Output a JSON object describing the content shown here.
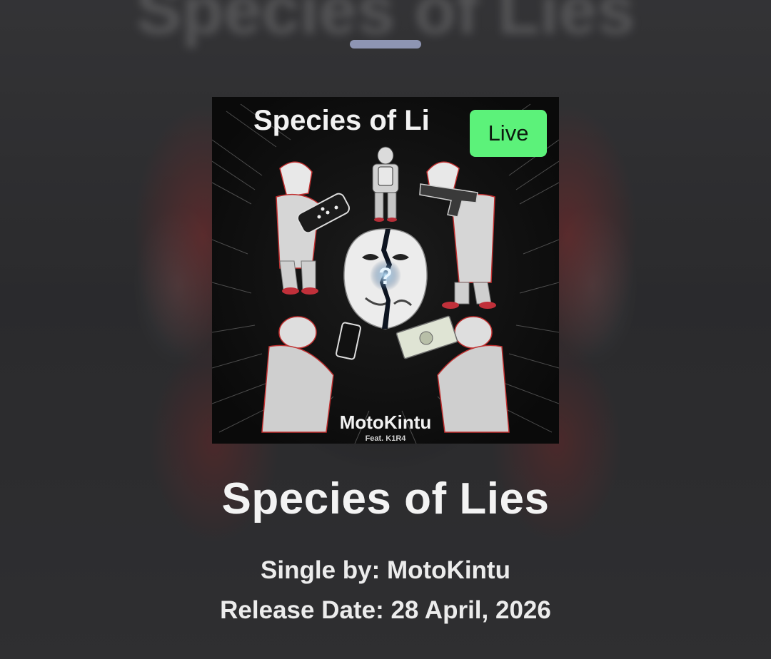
{
  "sheet": {
    "backdrop_title": "Species of Lies",
    "live_badge": "Live"
  },
  "cover": {
    "title_text": "Species of Li",
    "artist_text": "MotoKintu",
    "feat_text": "Feat. K1R4",
    "mask_symbol": "?"
  },
  "song": {
    "title": "Species of Lies",
    "artist_line": "Single by: MotoKintu",
    "release_line": "Release Date: 28 April, 2026"
  },
  "colors": {
    "live_badge": "#5cf27a",
    "drag_handle": "#8e95b3",
    "text": "#f3f3f3"
  }
}
